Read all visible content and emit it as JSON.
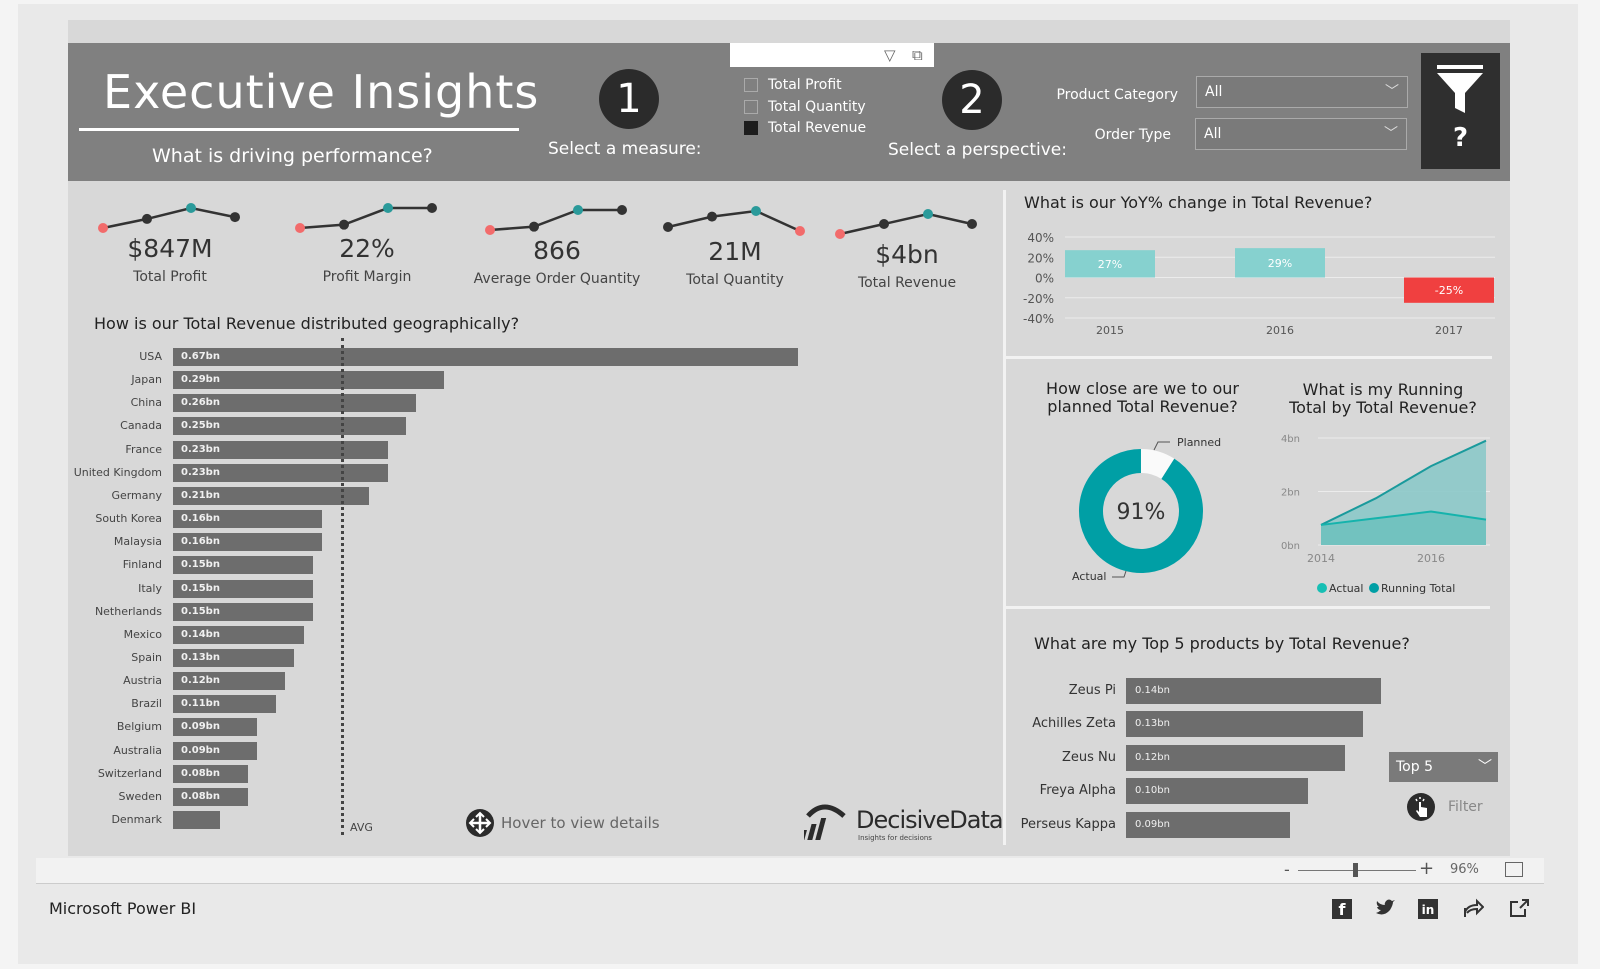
{
  "header": {
    "title": "Executive Insights",
    "subtitle": "What is driving performance?",
    "step1": "1",
    "step1_label": "Select a measure:",
    "step2": "2",
    "step2_label": "Select a perspective:",
    "measures": [
      {
        "label": "Total Profit",
        "checked": false
      },
      {
        "label": "Total Quantity",
        "checked": false
      },
      {
        "label": "Total Revenue",
        "checked": true
      }
    ],
    "product_category_label": "Product Category",
    "product_category_value": "All",
    "order_type_label": "Order Type",
    "order_type_value": "All",
    "help_label": "?"
  },
  "kpis": [
    {
      "value": "$847M",
      "label": "Total Profit",
      "trend": [
        2,
        3,
        4.2,
        3.2
      ],
      "low": 0,
      "high": 2
    },
    {
      "value": "22%",
      "label": "Profit Margin",
      "trend": [
        1,
        1.5,
        4,
        4
      ],
      "low": 0,
      "high": 2
    },
    {
      "value": "866",
      "label": "Average Order Quantity",
      "trend": [
        1,
        1.5,
        4,
        4
      ],
      "low": 0,
      "high": 2
    },
    {
      "value": "21M",
      "label": "Total Quantity",
      "trend": [
        2.5,
        3.8,
        4.5,
        2
      ],
      "low": 3,
      "high": 2
    },
    {
      "value": "$4bn",
      "label": "Total Revenue",
      "trend": [
        1,
        2,
        3,
        2
      ],
      "low": 0,
      "high": 2
    }
  ],
  "geo": {
    "title": "How is our Total Revenue distributed geographically?",
    "avg_label": "AVG",
    "avg_value": 0.2,
    "hover_hint": "Hover to view details"
  },
  "yoy": {
    "title": "What is our YoY% change in Total Revenue?"
  },
  "donut": {
    "title_line1": "How close are we to our",
    "title_line2": "planned Total Revenue?",
    "center": "91%",
    "planned_label": "Planned",
    "actual_label": "Actual"
  },
  "running": {
    "title_line1": "What is my Running",
    "title_line2": "Total by Total Revenue?"
  },
  "top5": {
    "title": "What are my Top 5 products by Total Revenue?",
    "selector_value": "Top 5",
    "filter_label": "Filter"
  },
  "logo": {
    "name": "DecisiveData",
    "tagline": "Insights for decisions"
  },
  "footer": {
    "brand": "Microsoft Power BI",
    "zoom_minus": "-",
    "zoom_plus": "+",
    "zoom_level": "96%",
    "zoom_fraction": 0.48
  },
  "colors": {
    "teal": "#009fa5",
    "teal_light": "#86d1cf",
    "red": "#f04040",
    "dot_red": "#f26b6b",
    "dot_teal": "#2a9a9a",
    "bar_gray": "#6d6d6d",
    "header_gray": "#808080"
  },
  "chart_data": [
    {
      "type": "bar",
      "orientation": "horizontal",
      "title": "How is our Total Revenue distributed geographically?",
      "categories": [
        "USA",
        "Japan",
        "China",
        "Canada",
        "France",
        "United Kingdom",
        "Germany",
        "South Korea",
        "Malaysia",
        "Finland",
        "Italy",
        "Netherlands",
        "Mexico",
        "Spain",
        "Austria",
        "Brazil",
        "Belgium",
        "Australia",
        "Switzerland",
        "Sweden",
        "Denmark"
      ],
      "values": [
        0.67,
        0.29,
        0.26,
        0.25,
        0.23,
        0.23,
        0.21,
        0.16,
        0.16,
        0.15,
        0.15,
        0.15,
        0.14,
        0.13,
        0.12,
        0.11,
        0.09,
        0.09,
        0.08,
        0.08,
        0.05
      ],
      "data_labels": [
        "0.67bn",
        "0.29bn",
        "0.26bn",
        "0.25bn",
        "0.23bn",
        "0.23bn",
        "0.21bn",
        "0.16bn",
        "0.16bn",
        "0.15bn",
        "0.15bn",
        "0.15bn",
        "0.14bn",
        "0.13bn",
        "0.12bn",
        "0.11bn",
        "0.09bn",
        "0.09bn",
        "0.08bn",
        "0.08bn",
        ""
      ],
      "unit": "bn",
      "reference_line": {
        "label": "AVG",
        "value": 0.18
      }
    },
    {
      "type": "bar",
      "title": "What is our YoY% change in Total Revenue?",
      "categories": [
        "2015",
        "2016",
        "2017"
      ],
      "values": [
        27,
        29,
        -25
      ],
      "data_labels": [
        "27%",
        "29%",
        "-25%"
      ],
      "ylim": [
        -40,
        40
      ],
      "yticks": [
        "40%",
        "20%",
        "0%",
        "-20%",
        "-40%"
      ],
      "grid": true
    },
    {
      "type": "pie",
      "variant": "donut",
      "title": "How close are we to our planned Total Revenue?",
      "slices": [
        {
          "label": "Actual",
          "value": 91
        },
        {
          "label": "Planned",
          "value": 9
        }
      ],
      "center_label": "91%"
    },
    {
      "type": "area",
      "title": "What is my Running Total by Total Revenue?",
      "x": [
        2014,
        2015,
        2016,
        2017
      ],
      "series": [
        {
          "name": "Actual",
          "values": [
            0.75,
            1.0,
            1.25,
            0.95
          ]
        },
        {
          "name": "Running Total",
          "values": [
            0.75,
            1.75,
            2.95,
            3.9
          ]
        }
      ],
      "ylim": [
        0,
        4
      ],
      "yticks": [
        "4bn",
        "2bn",
        "0bn"
      ],
      "xticks": [
        "2014",
        "2016"
      ],
      "legend": "bottom"
    },
    {
      "type": "bar",
      "orientation": "horizontal",
      "title": "What are my Top 5 products by Total Revenue?",
      "categories": [
        "Zeus Pi",
        "Achilles Zeta",
        "Zeus Nu",
        "Freya Alpha",
        "Perseus Kappa"
      ],
      "values": [
        0.14,
        0.13,
        0.12,
        0.1,
        0.09
      ],
      "data_labels": [
        "0.14bn",
        "0.13bn",
        "0.12bn",
        "0.10bn",
        "0.09bn"
      ]
    }
  ]
}
